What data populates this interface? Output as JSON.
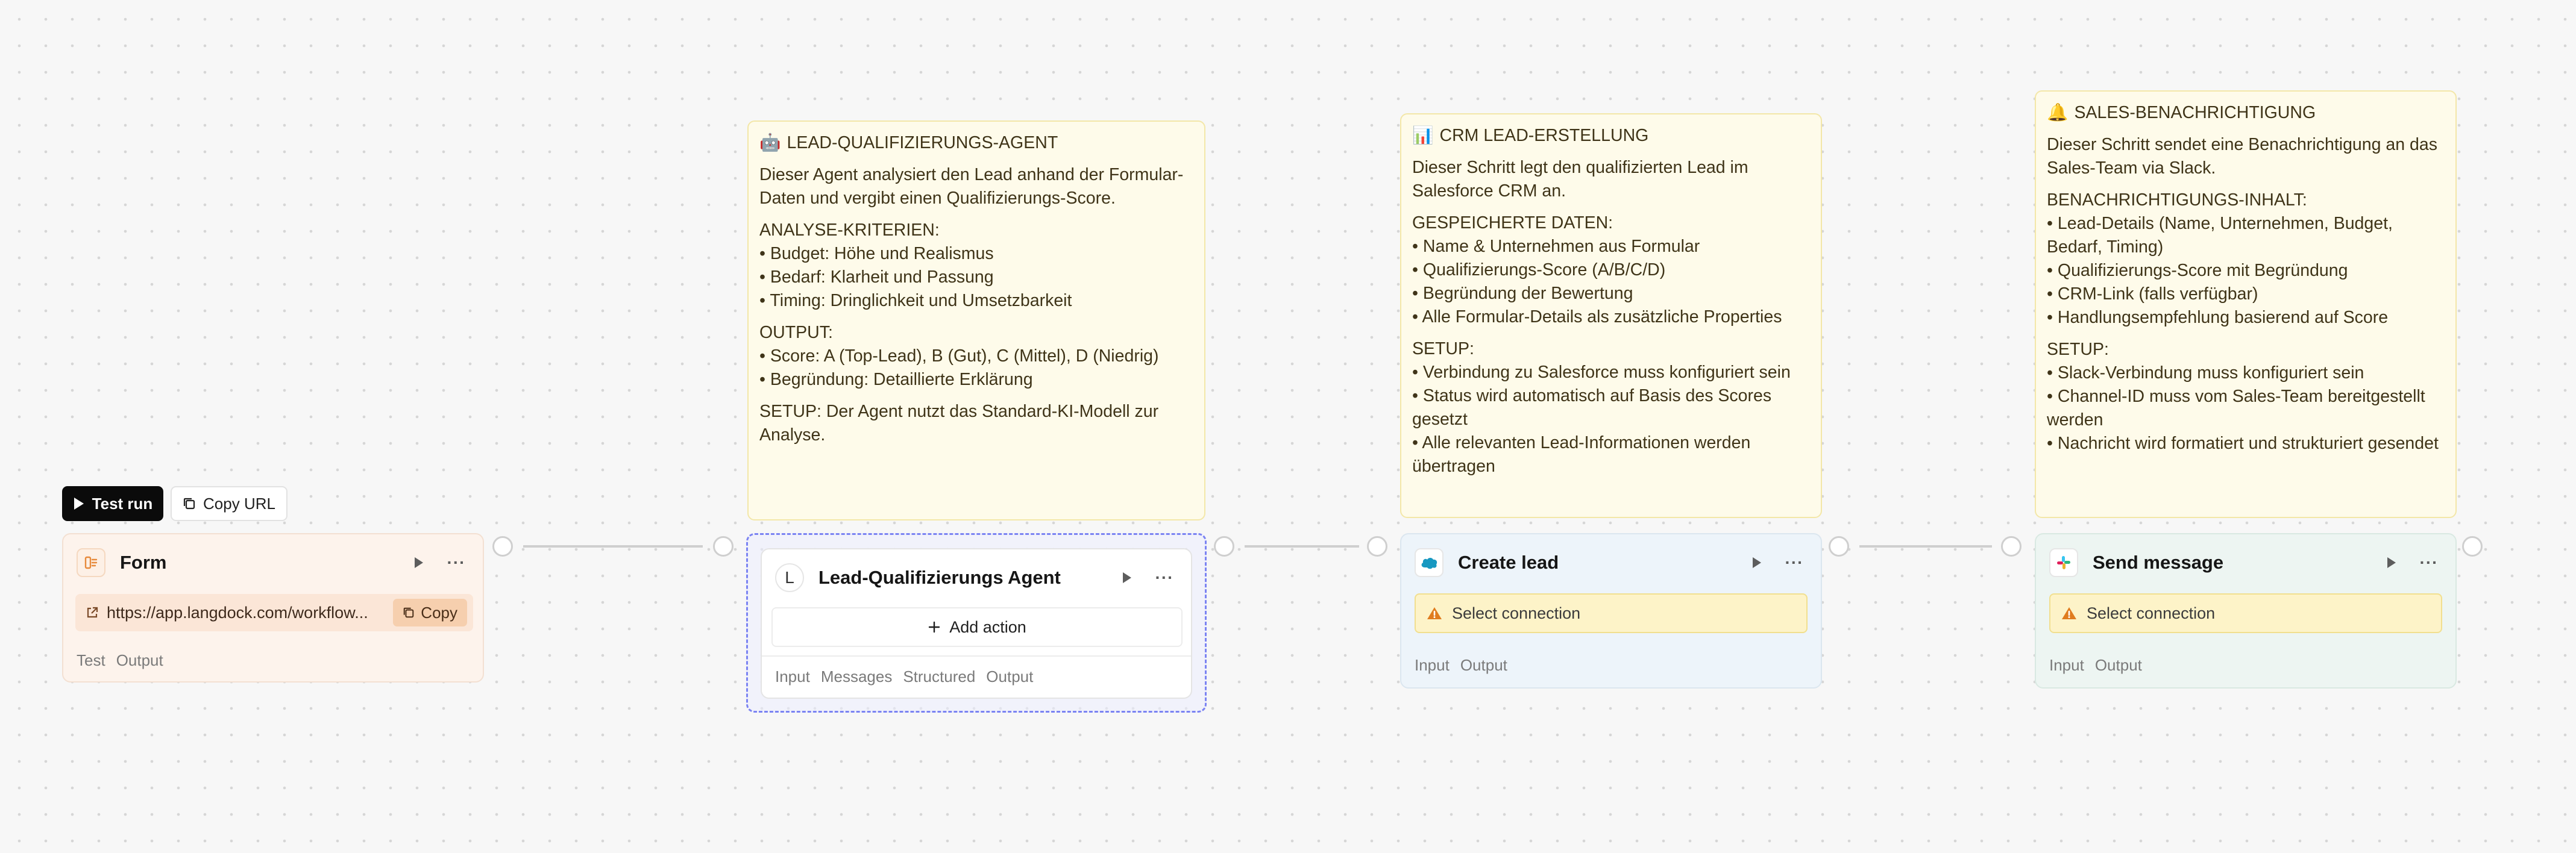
{
  "toolbar": {
    "test_run_label": "Test run",
    "copy_url_label": "Copy URL"
  },
  "nodes": {
    "form": {
      "title": "Form",
      "url": "https://app.langdock.com/workflow...",
      "copy_label": "Copy",
      "tabs": [
        "Test",
        "Output"
      ]
    },
    "agent": {
      "avatar_letter": "L",
      "title": "Lead-Qualifizierungs Agent",
      "add_action_label": "Add action",
      "tabs": [
        "Input",
        "Messages",
        "Structured",
        "Output"
      ]
    },
    "create_lead": {
      "title": "Create lead",
      "warning": "Select connection",
      "tabs": [
        "Input",
        "Output"
      ]
    },
    "send_message": {
      "title": "Send message",
      "warning": "Select connection",
      "tabs": [
        "Input",
        "Output"
      ]
    }
  },
  "notes": {
    "agent": {
      "emoji": "🤖",
      "title": "LEAD-QUALIFIZIERUNGS-AGENT",
      "paragraphs": [
        "Dieser Agent analysiert den Lead anhand der Formular-Daten und vergibt einen Qualifizierungs-Score.",
        "ANALYSE-KRITERIEN:\n• Budget: Höhe und Realismus\n• Bedarf: Klarheit und Passung\n• Timing: Dringlichkeit und Umsetzbarkeit",
        "OUTPUT:\n• Score: A (Top-Lead), B (Gut), C (Mittel), D (Niedrig)\n• Begründung: Detaillierte Erklärung",
        "SETUP: Der Agent nutzt das Standard-KI-Modell zur Analyse."
      ]
    },
    "crm": {
      "emoji": "📊",
      "title": "CRM LEAD-ERSTELLUNG",
      "paragraphs": [
        "Dieser Schritt legt den qualifizierten Lead im Salesforce CRM an.",
        "GESPEICHERTE DATEN:\n• Name & Unternehmen aus Formular\n• Qualifizierungs-Score (A/B/C/D)\n• Begründung der Bewertung\n• Alle Formular-Details als zusätzliche Properties",
        "SETUP:\n• Verbindung zu Salesforce muss konfiguriert sein\n• Status wird automatisch auf Basis des Scores gesetzt\n• Alle relevanten Lead-Informationen werden übertragen"
      ]
    },
    "sales": {
      "emoji": "🔔",
      "title": "SALES-BENACHRICHTIGUNG",
      "paragraphs": [
        "Dieser Schritt sendet eine Benachrichtigung an das Sales-Team via Slack.",
        "BENACHRICHTIGUNGS-INHALT:\n• Lead-Details (Name, Unternehmen, Budget, Bedarf, Timing)\n• Qualifizierungs-Score mit Begründung\n• CRM-Link (falls verfügbar)\n• Handlungsempfehlung basierend auf Score",
        "SETUP:\n• Slack-Verbindung muss konfiguriert sein\n• Channel-ID muss vom Sales-Team bereitgestellt werden\n• Nachricht wird formatiert und strukturiert gesendet"
      ]
    }
  },
  "colors": {
    "form_bg": "#fdf3ec",
    "agent_selected_border": "#7b83f2",
    "crm_bg": "#edf4fa",
    "slack_bg": "#edf5f2",
    "note_bg": "#fefbea",
    "warning_bg": "#fdf3c8"
  }
}
